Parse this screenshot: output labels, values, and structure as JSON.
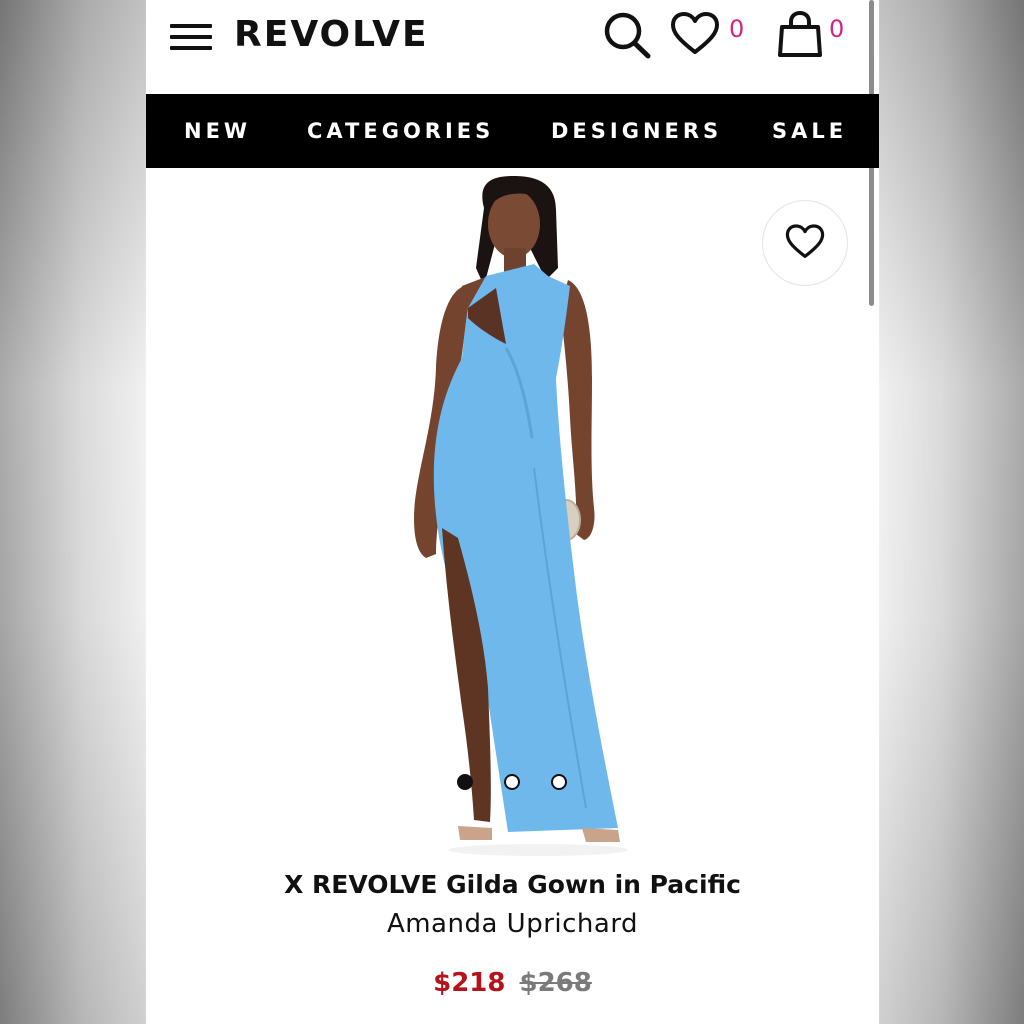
{
  "header": {
    "logo": "REVOLVE",
    "wishlist_count": "0",
    "bag_count": "0"
  },
  "nav": {
    "items": [
      "NEW",
      "CATEGORIES",
      "DESIGNERS",
      "SALE"
    ]
  },
  "product": {
    "title": "X REVOLVE Gilda Gown in Pacific",
    "brand": "Amanda Uprichard",
    "sale_price": "$218",
    "original_price": "$268",
    "image_count": 3,
    "active_image": 1,
    "dress_color": "#6fb8ec"
  },
  "colors": {
    "accent_pink": "#d4267e",
    "sale_red": "#b5121b",
    "nav_bg": "#000000"
  },
  "icons": [
    "hamburger-menu-icon",
    "search-icon",
    "heart-icon",
    "shopping-bag-icon"
  ]
}
